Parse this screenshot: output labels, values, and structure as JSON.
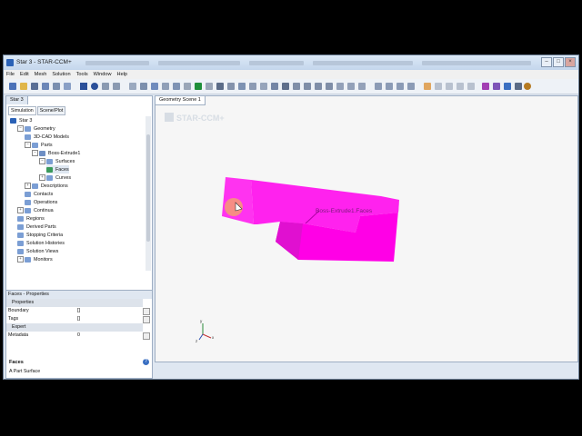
{
  "window": {
    "title": "Star 3 - STAR-CCM+",
    "buttons": {
      "minimize": "–",
      "maximize": "□",
      "close": "×"
    }
  },
  "menu": [
    "File",
    "Edit",
    "Mesh",
    "Solution",
    "Tools",
    "Window",
    "Help"
  ],
  "left_panel": {
    "tab": "Star 3",
    "subtabs": [
      "Simulation",
      "Scene/Plot"
    ],
    "tree": [
      {
        "label": "Star 3",
        "depth": 0,
        "exp": "",
        "icon": "root"
      },
      {
        "label": "Geometry",
        "depth": 1,
        "exp": "−",
        "icon": "folder"
      },
      {
        "label": "3D-CAD Models",
        "depth": 2,
        "exp": "",
        "icon": "folder"
      },
      {
        "label": "Parts",
        "depth": 2,
        "exp": "−",
        "icon": "folder"
      },
      {
        "label": "Boss-Extrude1",
        "depth": 3,
        "exp": "−",
        "icon": "part"
      },
      {
        "label": "Surfaces",
        "depth": 4,
        "exp": "−",
        "icon": "folder"
      },
      {
        "label": "Faces",
        "depth": 5,
        "exp": "",
        "icon": "face",
        "selected": true
      },
      {
        "label": "Curves",
        "depth": 4,
        "exp": "+",
        "icon": "folder"
      },
      {
        "label": "Descriptions",
        "depth": 2,
        "exp": "+",
        "icon": "folder"
      },
      {
        "label": "Contacts",
        "depth": 2,
        "exp": "",
        "icon": "folder"
      },
      {
        "label": "Operations",
        "depth": 2,
        "exp": "",
        "icon": "folder"
      },
      {
        "label": "Continua",
        "depth": 1,
        "exp": "+",
        "icon": "folder"
      },
      {
        "label": "Regions",
        "depth": 1,
        "exp": "",
        "icon": "folder"
      },
      {
        "label": "Derived Parts",
        "depth": 1,
        "exp": "",
        "icon": "folder"
      },
      {
        "label": "Stopping Criteria",
        "depth": 1,
        "exp": "",
        "icon": "folder"
      },
      {
        "label": "Solution Histories",
        "depth": 1,
        "exp": "",
        "icon": "folder"
      },
      {
        "label": "Solution Views",
        "depth": 1,
        "exp": "",
        "icon": "folder"
      },
      {
        "label": "Monitors",
        "depth": 1,
        "exp": "+",
        "icon": "folder"
      }
    ]
  },
  "properties": {
    "title": "Faces - Properties",
    "rows": [
      {
        "type": "group",
        "label": "Properties"
      },
      {
        "type": "row",
        "label": "Boundary",
        "value": "[]"
      },
      {
        "type": "row",
        "label": "Tags",
        "value": "[]"
      },
      {
        "type": "group",
        "label": "Expert"
      },
      {
        "type": "row",
        "label": "Metadata",
        "value": "0"
      }
    ],
    "description_title": "Faces",
    "description": "A Part Surface",
    "help": "?"
  },
  "scene": {
    "tab": "Geometry Scene 1",
    "logo": "STAR-CCM+",
    "part_label": "Boss-Extrude1.Faces",
    "part_color": "#ff22ee",
    "axis": {
      "x": "x",
      "y": "y",
      "z": "z"
    }
  },
  "colors": {
    "accent": "#2a61b6",
    "selection": "#dfe7f1",
    "cursor_highlight": "#f4a46a"
  }
}
